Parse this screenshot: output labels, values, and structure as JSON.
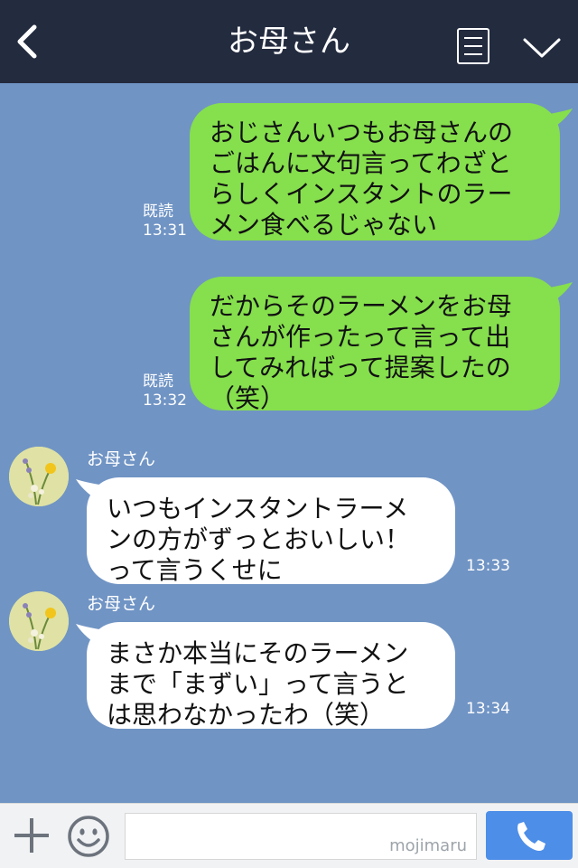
{
  "header": {
    "title": "お母さん",
    "back_icon": "chevron-left-icon",
    "menu_icon": "menu-list-icon",
    "collapse_icon": "chevron-down-icon",
    "background": "#232b3f"
  },
  "colors": {
    "chat_background": "#7094c4",
    "my_bubble": "#86df4d",
    "their_bubble": "#ffffff"
  },
  "messages": [
    {
      "from": "me",
      "read": "既読",
      "time": "13:31",
      "lines": [
        "おじさんいつもお母さんの",
        "ごはんに文句言ってわざと",
        "らしくインスタントのラー",
        "メン食べるじゃない"
      ]
    },
    {
      "from": "me",
      "read": "既読",
      "time": "13:32",
      "lines": [
        "だからそのラーメンをお母",
        "さんが作ったって言って出",
        "してみればって提案したの",
        "（笑）"
      ]
    },
    {
      "from": "other",
      "sender": "お母さん",
      "time": "13:33",
      "lines": [
        "いつもインスタントラーメ",
        "ンの方がずっとおいしい！",
        "って言うくせに"
      ]
    },
    {
      "from": "other",
      "sender": "お母さん",
      "time": "13:34",
      "lines": [
        "まさか本当にそのラーメン",
        "まで「まずい」って言うと",
        "は思わなかったわ（笑）"
      ]
    }
  ],
  "footer": {
    "plus_icon": "plus-icon",
    "emoji_icon": "smiley-icon",
    "input_value": "",
    "watermark": "mojimaru",
    "call_icon": "phone-icon"
  }
}
